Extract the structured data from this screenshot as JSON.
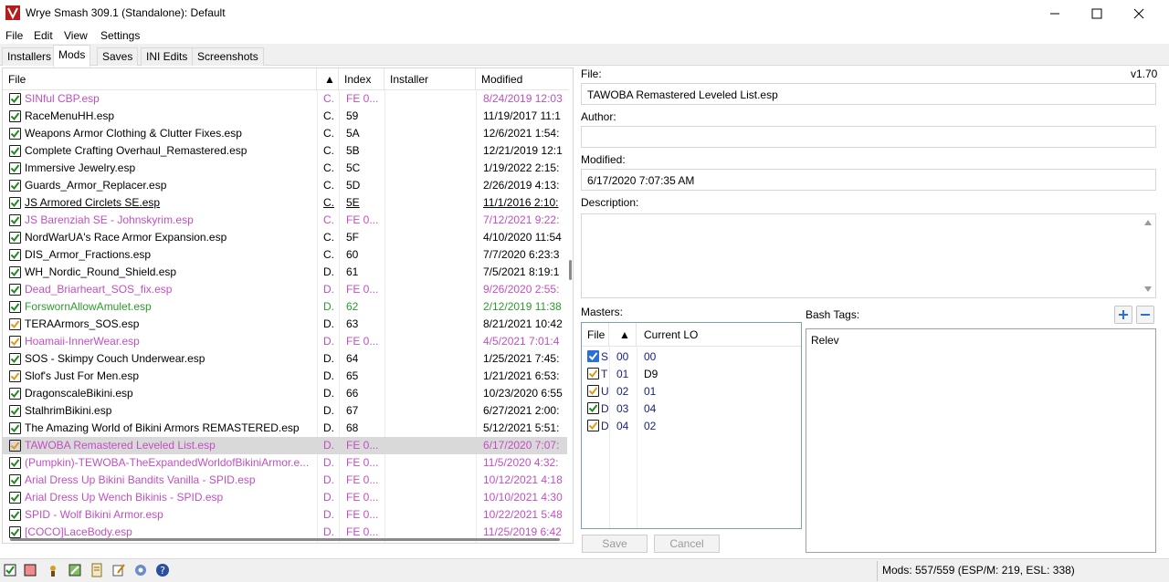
{
  "window": {
    "title": "Wrye Smash 309.1 (Standalone): Default"
  },
  "menu": {
    "items": [
      "File",
      "Edit",
      "View",
      "Settings"
    ]
  },
  "tabs": [
    "Installers",
    "Mods",
    "Saves",
    "INI Edits",
    "Screenshots"
  ],
  "active_tab": "Mods",
  "modlist": {
    "columns": {
      "file": "File",
      "index": "Index",
      "installer": "Installer",
      "modified": "Modified"
    },
    "sort_indicator": "▲",
    "rows": [
      {
        "file": "SINful CBP.esp",
        "flag": "C.",
        "index": "FE 0...",
        "modified": "8/24/2019 12:03",
        "color": "#c24fc2",
        "check": "green"
      },
      {
        "file": "RaceMenuHH.esp",
        "flag": "C.",
        "index": "59",
        "modified": "11/19/2017 11:1",
        "color": "#000000",
        "check": "green"
      },
      {
        "file": "Weapons Armor Clothing & Clutter Fixes.esp",
        "flag": "C.",
        "index": "5A",
        "modified": "12/6/2021 1:54:",
        "color": "#000000",
        "check": "green"
      },
      {
        "file": "Complete Crafting Overhaul_Remastered.esp",
        "flag": "C.",
        "index": "5B",
        "modified": "12/21/2019 12:1",
        "color": "#000000",
        "check": "green"
      },
      {
        "file": "Immersive Jewelry.esp",
        "flag": "C.",
        "index": "5C",
        "modified": "1/19/2022 2:15:",
        "color": "#000000",
        "check": "green"
      },
      {
        "file": "Guards_Armor_Replacer.esp",
        "flag": "C.",
        "index": "5D",
        "modified": "2/26/2019 4:13:",
        "color": "#000000",
        "check": "green"
      },
      {
        "file": "JS Armored Circlets SE.esp",
        "flag": "C.",
        "index": "5E",
        "modified": "11/1/2016 2:10:",
        "color": "#000000",
        "check": "green",
        "underline": true
      },
      {
        "file": "JS Barenziah SE - Johnskyrim.esp",
        "flag": "C.",
        "index": "FE 0...",
        "modified": "7/12/2021 9:22:",
        "color": "#c24fc2",
        "check": "green"
      },
      {
        "file": "NordWarUA's Race Armor Expansion.esp",
        "flag": "C.",
        "index": "5F",
        "modified": "4/10/2020 11:54",
        "color": "#000000",
        "check": "green"
      },
      {
        "file": "DIS_Armor_Fractions.esp",
        "flag": "C.",
        "index": "60",
        "modified": "7/7/2020 6:23:3",
        "color": "#000000",
        "check": "green"
      },
      {
        "file": "WH_Nordic_Round_Shield.esp",
        "flag": "D.",
        "index": "61",
        "modified": "7/5/2021 8:19:1",
        "color": "#000000",
        "check": "green"
      },
      {
        "file": "Dead_Briarheart_SOS_fix.esp",
        "flag": "D.",
        "index": "FE 0...",
        "modified": "9/26/2020 2:55:",
        "color": "#c24fc2",
        "check": "green"
      },
      {
        "file": "ForswornAllowAmulet.esp",
        "flag": "D.",
        "index": "62",
        "modified": "2/12/2019 11:38",
        "color": "#2e9a2e",
        "check": "green"
      },
      {
        "file": "TERAArmors_SOS.esp",
        "flag": "D.",
        "index": "63",
        "modified": "8/21/2021 10:42",
        "color": "#000000",
        "check": "orange"
      },
      {
        "file": "Hoamaii-InnerWear.esp",
        "flag": "D.",
        "index": "FE 0...",
        "modified": "4/5/2021 7:01:4",
        "color": "#c24fc2",
        "check": "orange"
      },
      {
        "file": "SOS - Skimpy Couch Underwear.esp",
        "flag": "D.",
        "index": "64",
        "modified": "1/25/2021 7:45:",
        "color": "#000000",
        "check": "green"
      },
      {
        "file": "Slof's Just For Men.esp",
        "flag": "D.",
        "index": "65",
        "modified": "1/21/2021 6:53:",
        "color": "#000000",
        "check": "orange"
      },
      {
        "file": "DragonscaleBikini.esp",
        "flag": "D.",
        "index": "66",
        "modified": "10/23/2020 6:55",
        "color": "#000000",
        "check": "green"
      },
      {
        "file": "StalhrimBikini.esp",
        "flag": "D.",
        "index": "67",
        "modified": "6/27/2021 2:00:",
        "color": "#000000",
        "check": "green"
      },
      {
        "file": "The Amazing World of Bikini Armors REMASTERED.esp",
        "flag": "D.",
        "index": "68",
        "modified": "5/12/2021 5:51:",
        "color": "#000000",
        "check": "green"
      },
      {
        "file": "TAWOBA Remastered Leveled List.esp",
        "flag": "D.",
        "index": "FE 0...",
        "modified": "6/17/2020 7:07:",
        "color": "#c24fc2",
        "check": "orange",
        "selected": true
      },
      {
        "file": "(Pumpkin)-TEWOBA-TheExpandedWorldofBikiniArmor.e...",
        "flag": "D.",
        "index": "FE 0...",
        "modified": "11/5/2020 4:32:",
        "color": "#c24fc2",
        "check": "green"
      },
      {
        "file": "Arial Dress Up Bikini Bandits Vanilla - SPID.esp",
        "flag": "D.",
        "index": "FE 0...",
        "modified": "10/12/2021 4:18",
        "color": "#c24fc2",
        "check": "green"
      },
      {
        "file": "Arial Dress Up Wench Bikinis - SPID.esp",
        "flag": "D.",
        "index": "FE 0...",
        "modified": "10/10/2021 4:30",
        "color": "#c24fc2",
        "check": "green"
      },
      {
        "file": "SPID - Wolf Bikini Armor.esp",
        "flag": "D.",
        "index": "FE 0...",
        "modified": "10/22/2021 5:48",
        "color": "#c24fc2",
        "check": "green"
      },
      {
        "file": "[COCO]LaceBody.esp",
        "flag": "D.",
        "index": "FE 0...",
        "modified": "11/25/2019 6:42",
        "color": "#c24fc2",
        "check": "green"
      }
    ]
  },
  "details": {
    "file_label": "File:",
    "version": "v1.70",
    "file_value": "TAWOBA Remastered Leveled List.esp",
    "author_label": "Author:",
    "author_value": "",
    "modified_label": "Modified:",
    "modified_value": "6/17/2020 7:07:35 AM",
    "description_label": "Description:",
    "masters_label": "Masters:",
    "bash_tags_label": "Bash Tags:",
    "bash_tags_value": "Relev",
    "save_label": "Save",
    "cancel_label": "Cancel"
  },
  "masters": {
    "columns": {
      "file": "File",
      "current_lo": "Current LO"
    },
    "sort_indicator": "▲",
    "rows": [
      {
        "letter": "S",
        "index": "00",
        "lo": "00",
        "check": "blue",
        "lo_color": "#1a237e"
      },
      {
        "letter": "T",
        "index": "01",
        "lo": "D9",
        "check": "orange",
        "lo_color": "#000000"
      },
      {
        "letter": "U",
        "index": "02",
        "lo": "01",
        "check": "orange",
        "lo_color": "#1a237e"
      },
      {
        "letter": "D",
        "index": "03",
        "lo": "04",
        "check": "green",
        "lo_color": "#1a237e"
      },
      {
        "letter": "D",
        "index": "04",
        "lo": "02",
        "check": "orange",
        "lo_color": "#1a237e"
      }
    ]
  },
  "status": {
    "text": "Mods: 557/559 (ESP/M: 219, ESL: 338)"
  },
  "colors": {
    "green_check": "#1f8a1f",
    "orange_check": "#e39a1b",
    "blue_check": "#2a6fd6",
    "selection": "#d9d9d9"
  }
}
